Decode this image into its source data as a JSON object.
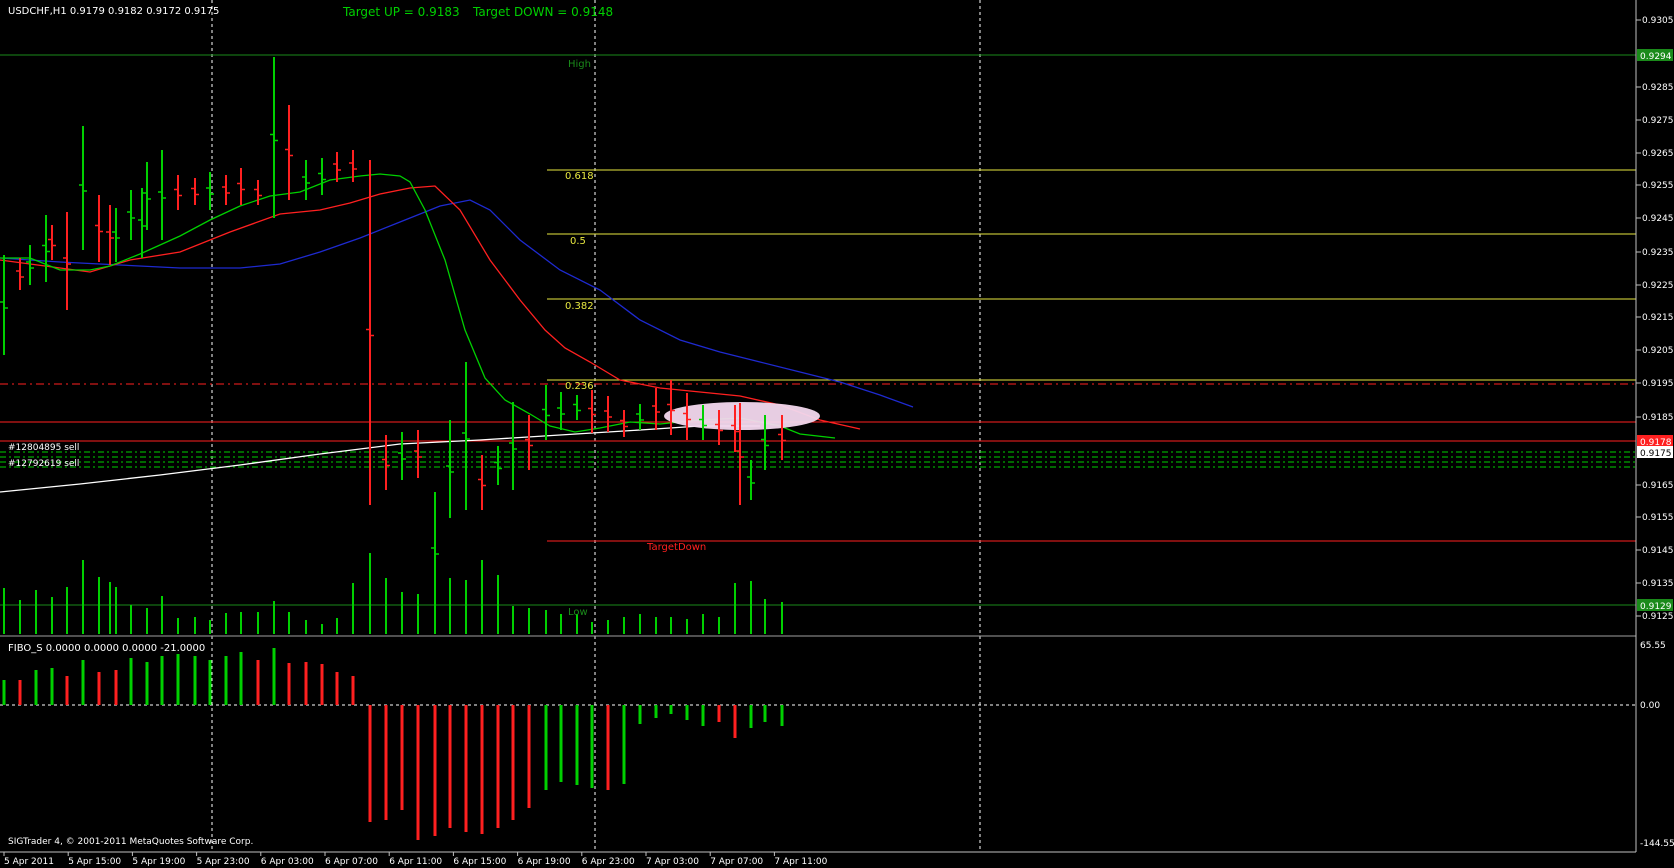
{
  "main": {
    "symbol_info": "USDCHF,H1  0.9179 0.9182 0.9172 0.9175",
    "target_up": "Target UP = 0.9183",
    "target_down": "Target DOWN = 0.9148",
    "level_high": "High",
    "level_low": "Low",
    "level_target_down": "TargetDown",
    "fib_labels": [
      "0.618",
      "0.5",
      "0.382",
      "0.236"
    ],
    "order_labels": [
      "#12804895 sell",
      "#12792619 sell"
    ],
    "price_ticks": [
      "0.9305",
      "0.9285",
      "0.9275",
      "0.9265",
      "0.9255",
      "0.9245",
      "0.9235",
      "0.9225",
      "0.9215",
      "0.9205",
      "0.9195",
      "0.9185",
      "0.9165",
      "0.9155",
      "0.9145",
      "0.9135",
      "0.9125"
    ],
    "price_badges": {
      "high": "0.9294",
      "order": "0.9178",
      "current": "0.9175",
      "low": "0.9129"
    },
    "colors": {
      "up": "#00d000",
      "down": "#ff2020",
      "ma_fast": "#00d000",
      "ma_mid": "#ff2020",
      "ma_slow": "#1e2ad0",
      "ma_long": "#ffffff",
      "fib": "#e8e840",
      "highlow": "#1a8a1a"
    }
  },
  "indicator": {
    "title": "FIBO_S 0.0000 0.0000 0.0000 -21.0000",
    "scale_ticks": [
      "65.55",
      "0.00",
      "-144.55"
    ]
  },
  "footer": {
    "copyright": "SIGTrader 4, © 2001-2011 MetaQuotes Software Corp."
  },
  "time_axis": [
    "5 Apr 2011",
    "5 Apr 15:00",
    "5 Apr 19:00",
    "5 Apr 23:00",
    "6 Apr 03:00",
    "6 Apr 07:00",
    "6 Apr 11:00",
    "6 Apr 15:00",
    "6 Apr 19:00",
    "6 Apr 23:00",
    "7 Apr 03:00",
    "7 Apr 07:00",
    "7 Apr 11:00"
  ]
}
